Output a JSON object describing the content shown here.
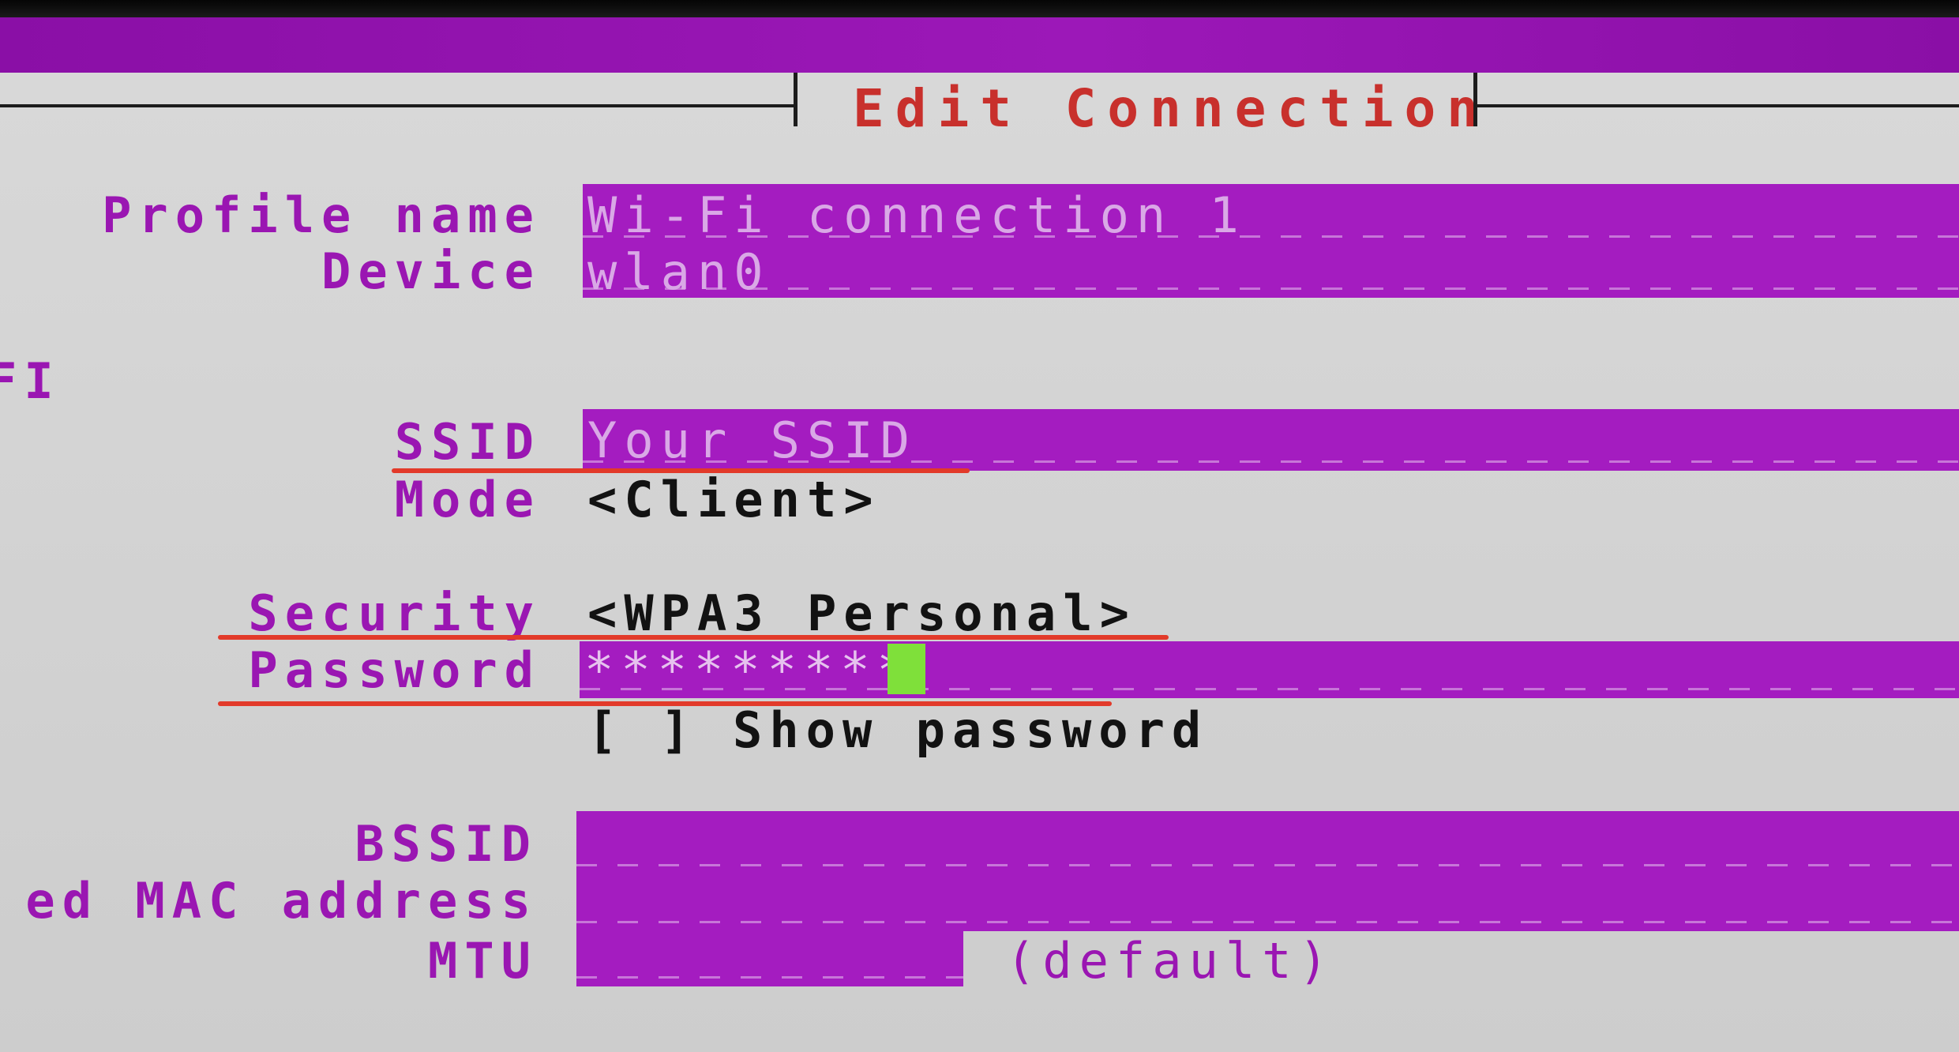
{
  "dialog": {
    "title": "Edit Connection"
  },
  "fields": {
    "profile_name": {
      "label": "Profile name",
      "value": "Wi-Fi connection 1"
    },
    "device": {
      "label": "Device",
      "value": "wlan0"
    },
    "section_label": "FI",
    "ssid": {
      "label": "SSID",
      "value": "Your SSID"
    },
    "mode": {
      "label": "Mode",
      "value": "<Client>"
    },
    "security": {
      "label": "Security",
      "value": "<WPA3 Personal>"
    },
    "password": {
      "label": "Password",
      "value": "*********"
    },
    "show_password": {
      "checkbox": "[ ]",
      "label": "Show password",
      "checked": false
    },
    "bssid": {
      "label": "BSSID",
      "value": ""
    },
    "cloned_mac": {
      "label": "ed MAC address",
      "value": ""
    },
    "mtu": {
      "label": "MTU",
      "value": "",
      "hint": "(default)"
    }
  },
  "colors": {
    "field_background": "#a41cc0",
    "label_color": "#9a16b2",
    "title_color": "#c8302c",
    "cursor_color": "#7fe03a",
    "annotation_color": "#e23a2a"
  }
}
